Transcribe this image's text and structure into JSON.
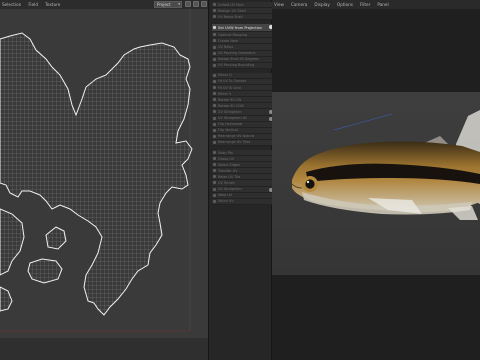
{
  "uv_editor": {
    "menu": [
      "Selection",
      "Field",
      "Texture"
    ],
    "dropdown_value": "Project"
  },
  "command_list": {
    "items": [
      {
        "label": "Unfold UV Face",
        "active": false,
        "gear": false
      },
      {
        "label": "Realign UV Shell",
        "active": false,
        "gear": false
      },
      {
        "label": "UV Relax Shell",
        "active": false,
        "gear": false
      },
      {
        "label": "Set UVW from Projection",
        "active": true,
        "gear": true
      },
      {
        "label": "Optimal Mapping",
        "active": false,
        "gear": false
      },
      {
        "label": "Create New",
        "active": false,
        "gear": false
      },
      {
        "label": "UV Relax",
        "active": false,
        "gear": false
      },
      {
        "label": "UV Packing Geometric",
        "active": false,
        "gear": false
      },
      {
        "label": "Rotate Shell 90 Degrees",
        "active": false,
        "gear": false
      },
      {
        "label": "UV Packing Bounding",
        "active": false,
        "gear": false
      },
      {
        "label": "Mirror U",
        "active": false,
        "gear": false
      },
      {
        "label": "Fit UV To Canvas",
        "active": false,
        "gear": false
      },
      {
        "label": "Fit UV To Grid",
        "active": false,
        "gear": false
      },
      {
        "label": "Mirror V",
        "active": false,
        "gear": false
      },
      {
        "label": "Rotate 90 CW",
        "active": false,
        "gear": false
      },
      {
        "label": "Rotate 90 CCW",
        "active": false,
        "gear": false
      },
      {
        "label": "UV Straighten",
        "active": false,
        "gear": true
      },
      {
        "label": "UV Straighten All",
        "active": false,
        "gear": true
      },
      {
        "label": "Flip Horizontal",
        "active": false,
        "gear": false
      },
      {
        "label": "Flip Vertical",
        "active": false,
        "gear": false
      },
      {
        "label": "Rearrange UV Islands",
        "active": false,
        "gear": false
      },
      {
        "label": "Rearrange UV Tiles",
        "active": false,
        "gear": false
      },
      {
        "label": "Snap Pts",
        "active": false,
        "gear": false
      },
      {
        "label": "Group UV",
        "active": false,
        "gear": false
      },
      {
        "label": "Select Edges",
        "active": false,
        "gear": false
      },
      {
        "label": "Transfer UV",
        "active": false,
        "gear": false
      },
      {
        "label": "Relax UV Tile",
        "active": false,
        "gear": false
      },
      {
        "label": "UV Terrain",
        "active": false,
        "gear": false
      },
      {
        "label": "UV Straighten",
        "active": false,
        "gear": true
      },
      {
        "label": "Weld UV",
        "active": false,
        "gear": false
      },
      {
        "label": "Stitch UV",
        "active": false,
        "gear": false
      }
    ]
  },
  "viewport": {
    "menu": [
      "View",
      "Camera",
      "Display",
      "Options",
      "Filter",
      "Panel"
    ]
  },
  "colors": {
    "uv_background": "#3a3a3a",
    "uv_wire": "#ececec",
    "active_command": "#454545",
    "fish_body": "#8a6428",
    "fish_stripe": "#151210",
    "fish_belly": "#c8c2ae"
  }
}
